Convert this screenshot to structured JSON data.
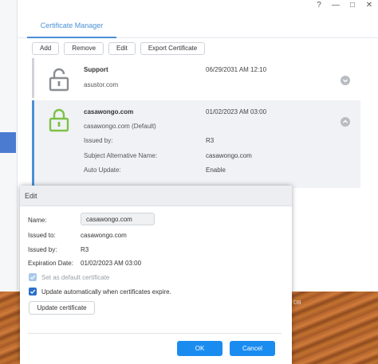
{
  "window": {
    "controls": {
      "help": "?",
      "minimize": "—",
      "maximize": "□",
      "close": "✕"
    },
    "tab": "Certificate Manager"
  },
  "toolbar": {
    "add": "Add",
    "remove": "Remove",
    "edit": "Edit",
    "export": "Export Certificate"
  },
  "certificates": [
    {
      "name": "Support",
      "subtitle": "asustor.com",
      "date": "06/29/2031 AM 12:10",
      "lock_color": "#8a8e93"
    },
    {
      "name": "casawongo.com",
      "subtitle": "casawongo.com (Default)",
      "date": "01/02/2023 AM 03:00",
      "lock_color": "#7cc247",
      "details": [
        {
          "label": "Issued by:",
          "value": "R3"
        },
        {
          "label": "Subject Alternative Name:",
          "value": "casawongo.com"
        },
        {
          "label": "Auto Update:",
          "value": "Enable"
        }
      ]
    }
  ],
  "wallpaper_text": "DB",
  "dialog": {
    "title": "Edit",
    "name_label": "Name:",
    "name_value": "casawongo.com",
    "issued_to_label": "Issued to:",
    "issued_to_value": "casawongo.com",
    "issued_by_label": "Issued by:",
    "issued_by_value": "R3",
    "expiration_label": "Expiration Date:",
    "expiration_value": "01/02/2023 AM 03:00",
    "set_default_label": "Set as default certificate",
    "set_default_checked": true,
    "auto_update_label": "Update automatically when certificates expire.",
    "auto_update_checked": true,
    "update_button": "Update certificate",
    "ok_button": "OK",
    "cancel_button": "Cancel"
  },
  "colors": {
    "accent": "#4a90d6",
    "primary_button": "#1a8cf0",
    "checkbox_checked": "#2d6fc9",
    "checkbox_disabled": "#a9c8ea"
  }
}
